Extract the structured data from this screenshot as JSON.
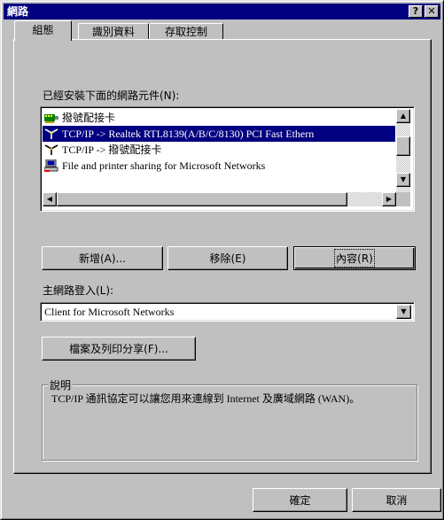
{
  "window": {
    "title": "網路",
    "help_button": "?",
    "close_button": "✕"
  },
  "tabs": [
    {
      "label": "組態",
      "active": true
    },
    {
      "label": "識別資料",
      "active": false
    },
    {
      "label": "存取控制",
      "active": false
    }
  ],
  "components_label": "已經安裝下面的網路元件(N):",
  "components": [
    {
      "icon": "network-adapter-icon",
      "label": "撥號配接卡",
      "selected": false
    },
    {
      "icon": "network-protocol-icon",
      "label": "TCP/IP -> Realtek RTL8139(A/B/C/8130) PCI Fast Ethern",
      "selected": true
    },
    {
      "icon": "network-protocol-icon",
      "label": "TCP/IP -> 撥號配接卡",
      "selected": false
    },
    {
      "icon": "file-printer-sharing-icon",
      "label": "File and printer sharing for Microsoft Networks",
      "selected": false
    }
  ],
  "buttons": {
    "add": "新增(A)...",
    "remove": "移除(E)",
    "properties": "內容(R)"
  },
  "primary_logon_label": "主網路登入(L):",
  "primary_logon_value": "Client for Microsoft Networks",
  "file_print_sharing_button": "檔案及列印分享(F)...",
  "description": {
    "title": "說明",
    "text": "TCP/IP 通訊協定可以讓您用來連線到 Internet 及廣域網路 (WAN)。"
  },
  "footer": {
    "ok": "確定",
    "cancel": "取消"
  }
}
